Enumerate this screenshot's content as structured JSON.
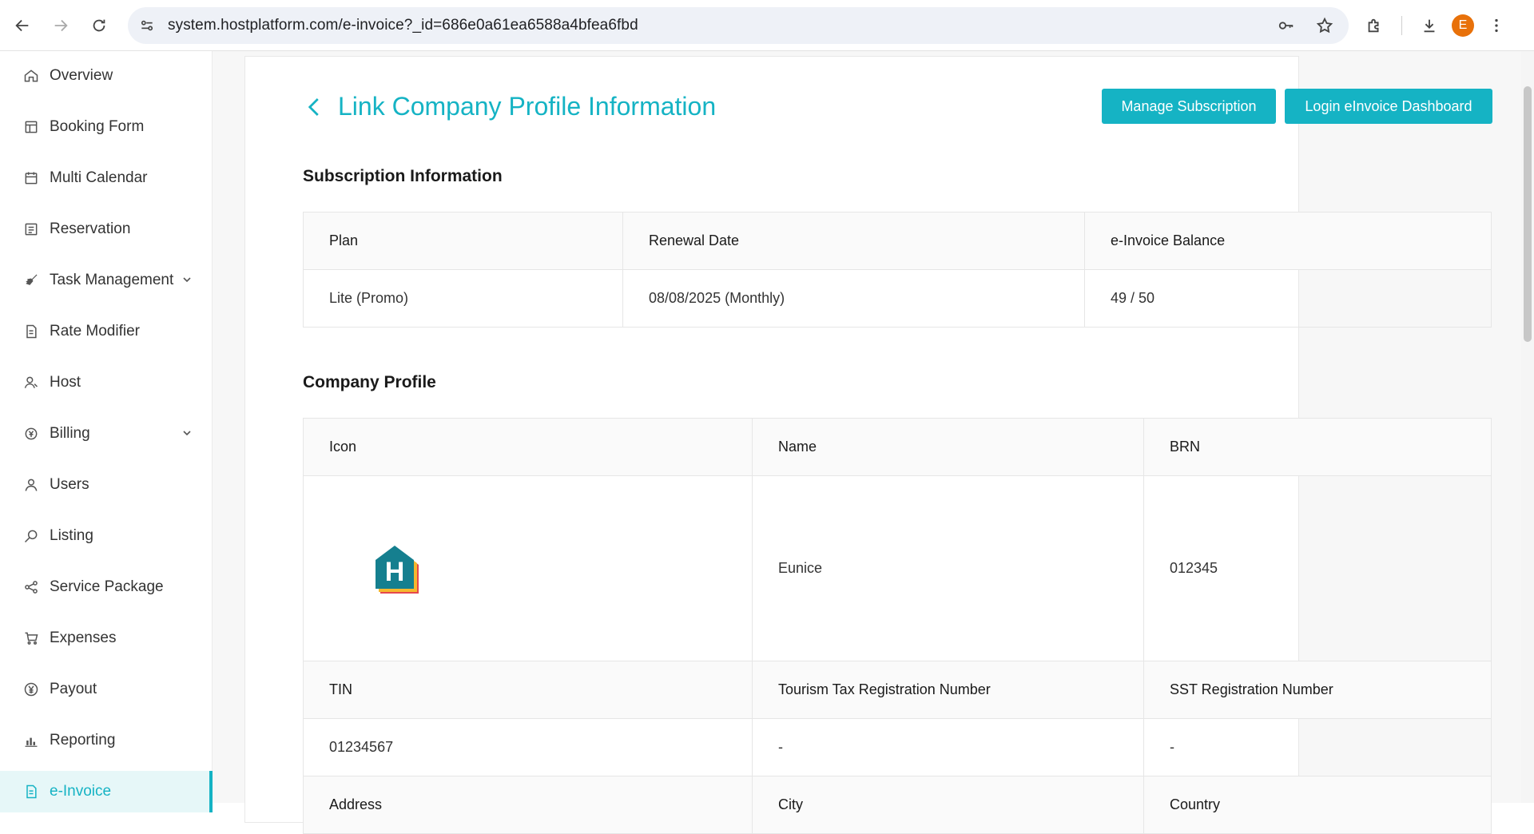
{
  "browser": {
    "url": "system.hostplatform.com/e-invoice?_id=686e0a61ea6588a4bfea6fbd",
    "avatar_letter": "E",
    "avatar_color": "#e8710a"
  },
  "sidebar": {
    "items": [
      {
        "label": "Overview",
        "icon": "home-icon"
      },
      {
        "label": "Booking Form",
        "icon": "form-icon"
      },
      {
        "label": "Multi Calendar",
        "icon": "calendar-icon"
      },
      {
        "label": "Reservation",
        "icon": "list-icon"
      },
      {
        "label": "Task Management",
        "icon": "broom-icon",
        "expandable": true
      },
      {
        "label": "Rate Modifier",
        "icon": "document-icon"
      },
      {
        "label": "Host",
        "icon": "host-icon"
      },
      {
        "label": "Billing",
        "icon": "billing-icon",
        "expandable": true
      },
      {
        "label": "Users",
        "icon": "user-icon"
      },
      {
        "label": "Listing",
        "icon": "search-icon"
      },
      {
        "label": "Service Package",
        "icon": "share-icon"
      },
      {
        "label": "Expenses",
        "icon": "cart-icon"
      },
      {
        "label": "Payout",
        "icon": "yen-icon"
      },
      {
        "label": "Reporting",
        "icon": "chart-icon"
      },
      {
        "label": "e-Invoice",
        "icon": "invoice-icon",
        "active": true
      }
    ]
  },
  "header": {
    "title": "Link Company Profile Information",
    "manage_label": "Manage Subscription",
    "login_label": "Login eInvoice Dashboard"
  },
  "subscription": {
    "title": "Subscription Information",
    "headers": [
      "Plan",
      "Renewal Date",
      "e-Invoice Balance"
    ],
    "values": [
      "Lite (Promo)",
      "08/08/2025 (Monthly)",
      "49 / 50"
    ]
  },
  "company": {
    "title": "Company Profile",
    "headers1": [
      "Icon",
      "Name",
      "BRN"
    ],
    "name": "Eunice",
    "brn": "012345",
    "logo_letter": "H",
    "headers2": [
      "TIN",
      "Tourism Tax Registration Number",
      "SST Registration Number"
    ],
    "values2": [
      "01234567",
      "-",
      "-"
    ],
    "headers3": [
      "Address",
      "City",
      "Country"
    ]
  },
  "colors": {
    "accent": "#15b3c4"
  }
}
